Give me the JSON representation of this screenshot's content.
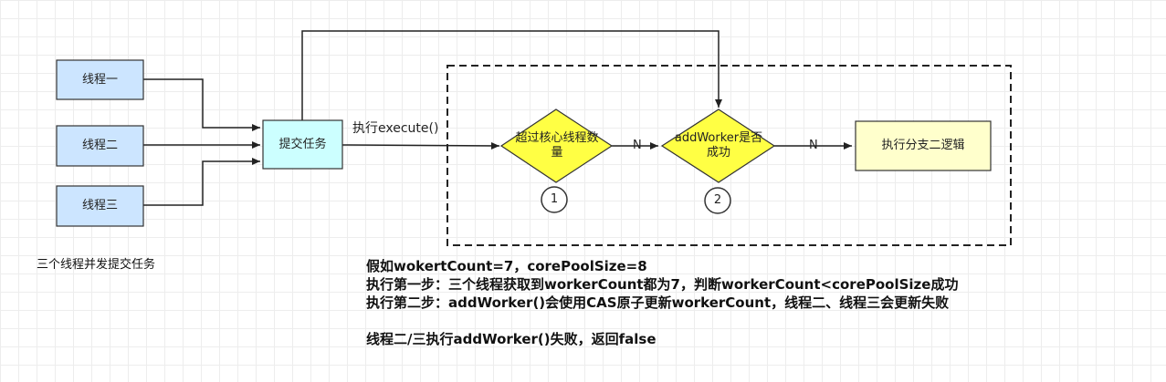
{
  "nodes": {
    "thread1": "线程一",
    "thread2": "线程二",
    "thread3": "线程三",
    "submit": "提交任务",
    "decision1": "超过核心线程数量",
    "decision2": "addWorker是否成功",
    "branch2": "执行分支二逻辑"
  },
  "edge_labels": {
    "execute": "执行execute()",
    "no1": "N",
    "no2": "N"
  },
  "markers": {
    "m1": "1",
    "m2": "2"
  },
  "caption": "三个线程并发提交任务",
  "notes": [
    "假如wokertCount=7，corePoolSize=8",
    "执行第一步：三个线程获取到workerCount都为7，判断workerCount<corePoolSize成功",
    "执行第二步：addWorker()会使用CAS原子更新workerCount，线程二、线程三会更新失败",
    "",
    "线程二/三执行addWorker()失败，返回false"
  ],
  "colors": {
    "thread_fill": "#cce5ff",
    "submit_fill": "#ccffff",
    "decision_fill": "#ffff44",
    "branch_fill": "#ffffcc",
    "stroke": "#333333"
  }
}
